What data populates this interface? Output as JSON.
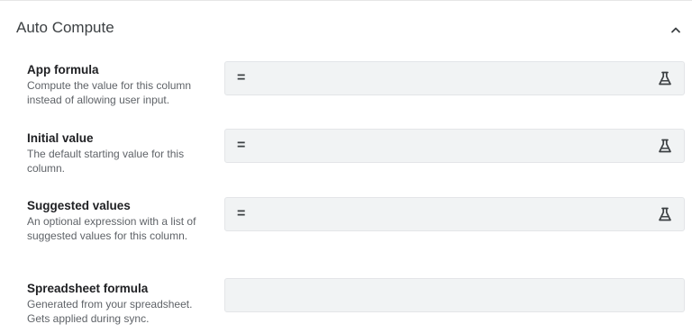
{
  "section": {
    "title": "Auto Compute",
    "collapse_icon": "chevron-up-icon"
  },
  "fields": [
    {
      "title": "App formula",
      "description": "Compute the value for this column instead of allowing user input.",
      "prefix": "=",
      "value": "",
      "action_icon": "flask-icon"
    },
    {
      "title": "Initial value",
      "description": "The default starting value for this column.",
      "prefix": "=",
      "value": "",
      "action_icon": "flask-icon"
    },
    {
      "title": "Suggested values",
      "description": "An optional expression with a list of suggested values for this column.",
      "prefix": "=",
      "value": "",
      "action_icon": "flask-icon"
    },
    {
      "title": "Spreadsheet formula",
      "description": "Generated from your spreadsheet. Gets applied during sync.",
      "value": ""
    }
  ],
  "colors": {
    "field_background": "#f1f3f4",
    "label_text": "#202124",
    "description_text": "#5f6368"
  }
}
